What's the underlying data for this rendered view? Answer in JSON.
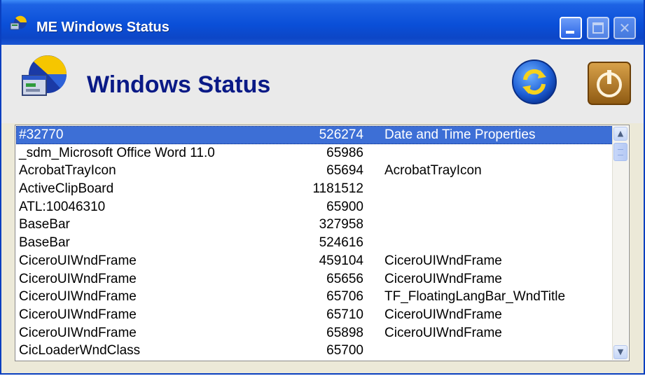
{
  "window": {
    "title": "ME Windows Status"
  },
  "header": {
    "title": "Windows Status"
  },
  "icons": {
    "title_icon": "app-logo-icon",
    "app_icon": "windows-status-logo-icon",
    "refresh": "refresh-icon",
    "power": "power-icon",
    "minimize": "minimize-icon",
    "maximize": "maximize-icon",
    "close": "close-icon"
  },
  "colors": {
    "titlebar": "#0a4fd8",
    "selection": "#3d6fd6",
    "header_text": "#0a1a86"
  },
  "windows_list": {
    "selected_index": 0,
    "rows": [
      {
        "class_name": "#32770",
        "handle": "526274",
        "title": "Date and Time Properties"
      },
      {
        "class_name": "_sdm_Microsoft Office Word 11.0",
        "handle": "65986",
        "title": ""
      },
      {
        "class_name": "AcrobatTrayIcon",
        "handle": "65694",
        "title": "AcrobatTrayIcon"
      },
      {
        "class_name": "ActiveClipBoard",
        "handle": "1181512",
        "title": ""
      },
      {
        "class_name": "ATL:10046310",
        "handle": "65900",
        "title": ""
      },
      {
        "class_name": "BaseBar",
        "handle": "327958",
        "title": ""
      },
      {
        "class_name": "BaseBar",
        "handle": "524616",
        "title": ""
      },
      {
        "class_name": "CiceroUIWndFrame",
        "handle": "459104",
        "title": "CiceroUIWndFrame"
      },
      {
        "class_name": "CiceroUIWndFrame",
        "handle": "65656",
        "title": "CiceroUIWndFrame"
      },
      {
        "class_name": "CiceroUIWndFrame",
        "handle": "65706",
        "title": "TF_FloatingLangBar_WndTitle"
      },
      {
        "class_name": "CiceroUIWndFrame",
        "handle": "65710",
        "title": "CiceroUIWndFrame"
      },
      {
        "class_name": "CiceroUIWndFrame",
        "handle": "65898",
        "title": "CiceroUIWndFrame"
      },
      {
        "class_name": "CicLoaderWndClass",
        "handle": "65700",
        "title": ""
      }
    ]
  }
}
